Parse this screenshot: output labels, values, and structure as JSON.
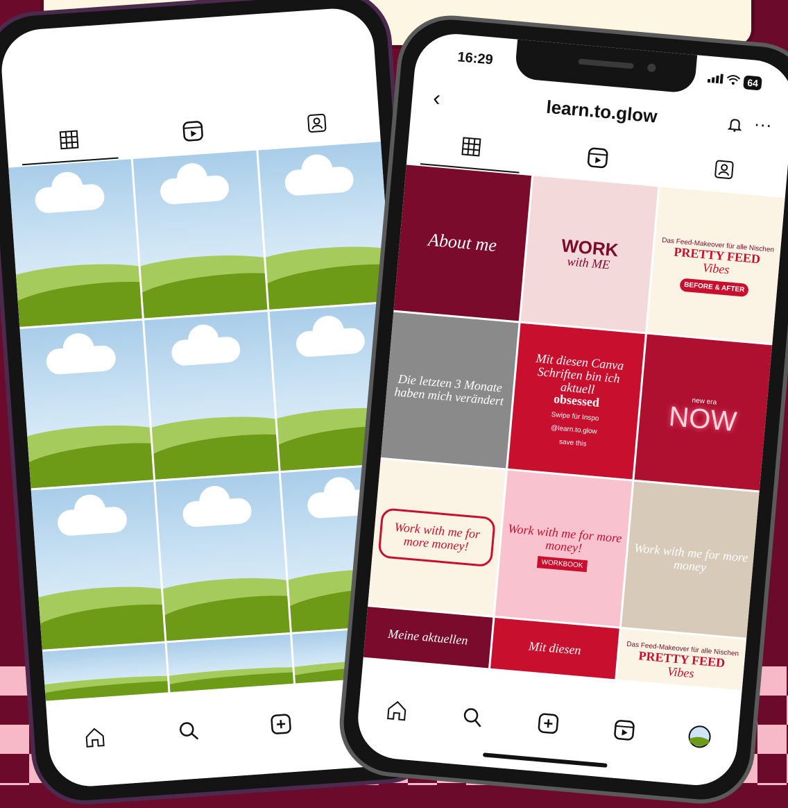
{
  "status": {
    "time": "16:29",
    "battery": "64"
  },
  "profile": {
    "username": "learn.to.glow"
  },
  "icons": {
    "back": "back-chevron-icon",
    "bell": "bell-icon",
    "more": "more-icon",
    "grid": "grid-icon",
    "reels": "reels-icon",
    "tagged": "tagged-icon",
    "home": "home-icon",
    "search": "search-icon",
    "add": "add-icon",
    "avatar": "avatar-icon"
  },
  "header": {
    "more_label": "···",
    "back_label": "‹"
  },
  "posts": [
    {
      "style": "wine",
      "lines": [
        "About me"
      ]
    },
    {
      "style": "bright",
      "lines": [
        "WORK",
        "with ME"
      ]
    },
    {
      "style": "cream",
      "lines": [
        "Das Feed-Makeover für alle Nischen",
        "PRETTY FEED",
        "Vibes",
        "BEFORE & AFTER"
      ]
    },
    {
      "style": "gray",
      "lines": [
        "Die letzten 3 Monate haben mich verändert"
      ]
    },
    {
      "style": "red",
      "lines": [
        "Mit diesen Canva Schriften bin ich aktuell",
        "obsessed",
        "Swipe für Inspo",
        "@learn.to.glow",
        "save this"
      ]
    },
    {
      "style": "neon",
      "lines": [
        "new era",
        "NOW"
      ]
    },
    {
      "style": "cream",
      "lines": [
        "Work with me for more money!"
      ]
    },
    {
      "style": "pink",
      "lines": [
        "Work with me for more money!",
        "WORKBOOK"
      ]
    },
    {
      "style": "beige",
      "lines": [
        "Work with me for more money"
      ]
    },
    {
      "style": "wine",
      "lines": [
        "Meine aktuellen"
      ]
    },
    {
      "style": "red",
      "lines": [
        "Mit diesen"
      ]
    },
    {
      "style": "cream",
      "lines": [
        "Das Feed-Makeover für alle Nischen",
        "PRETTY FEED",
        "Vibes"
      ]
    }
  ],
  "colors": {
    "background": "#6b0a2a",
    "checker_pink": "#f7b8c8",
    "banner": "#fdf6e3",
    "accent_red": "#c8102e",
    "wine": "#7a0b2c"
  }
}
